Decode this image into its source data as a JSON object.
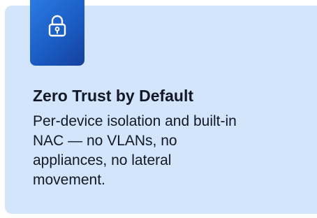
{
  "feature": {
    "icon": "lock-icon",
    "title": "Zero Trust by Default",
    "description_lines": [
      "Per-device isolation and built-in",
      "NAC — no VLANs, no",
      "appliances, no lateral",
      "movement."
    ]
  },
  "colors": {
    "card_background": "#d3e5fb",
    "icon_tile_gradient": [
      "#2b7be3",
      "#17409b"
    ],
    "text": "#121826"
  }
}
